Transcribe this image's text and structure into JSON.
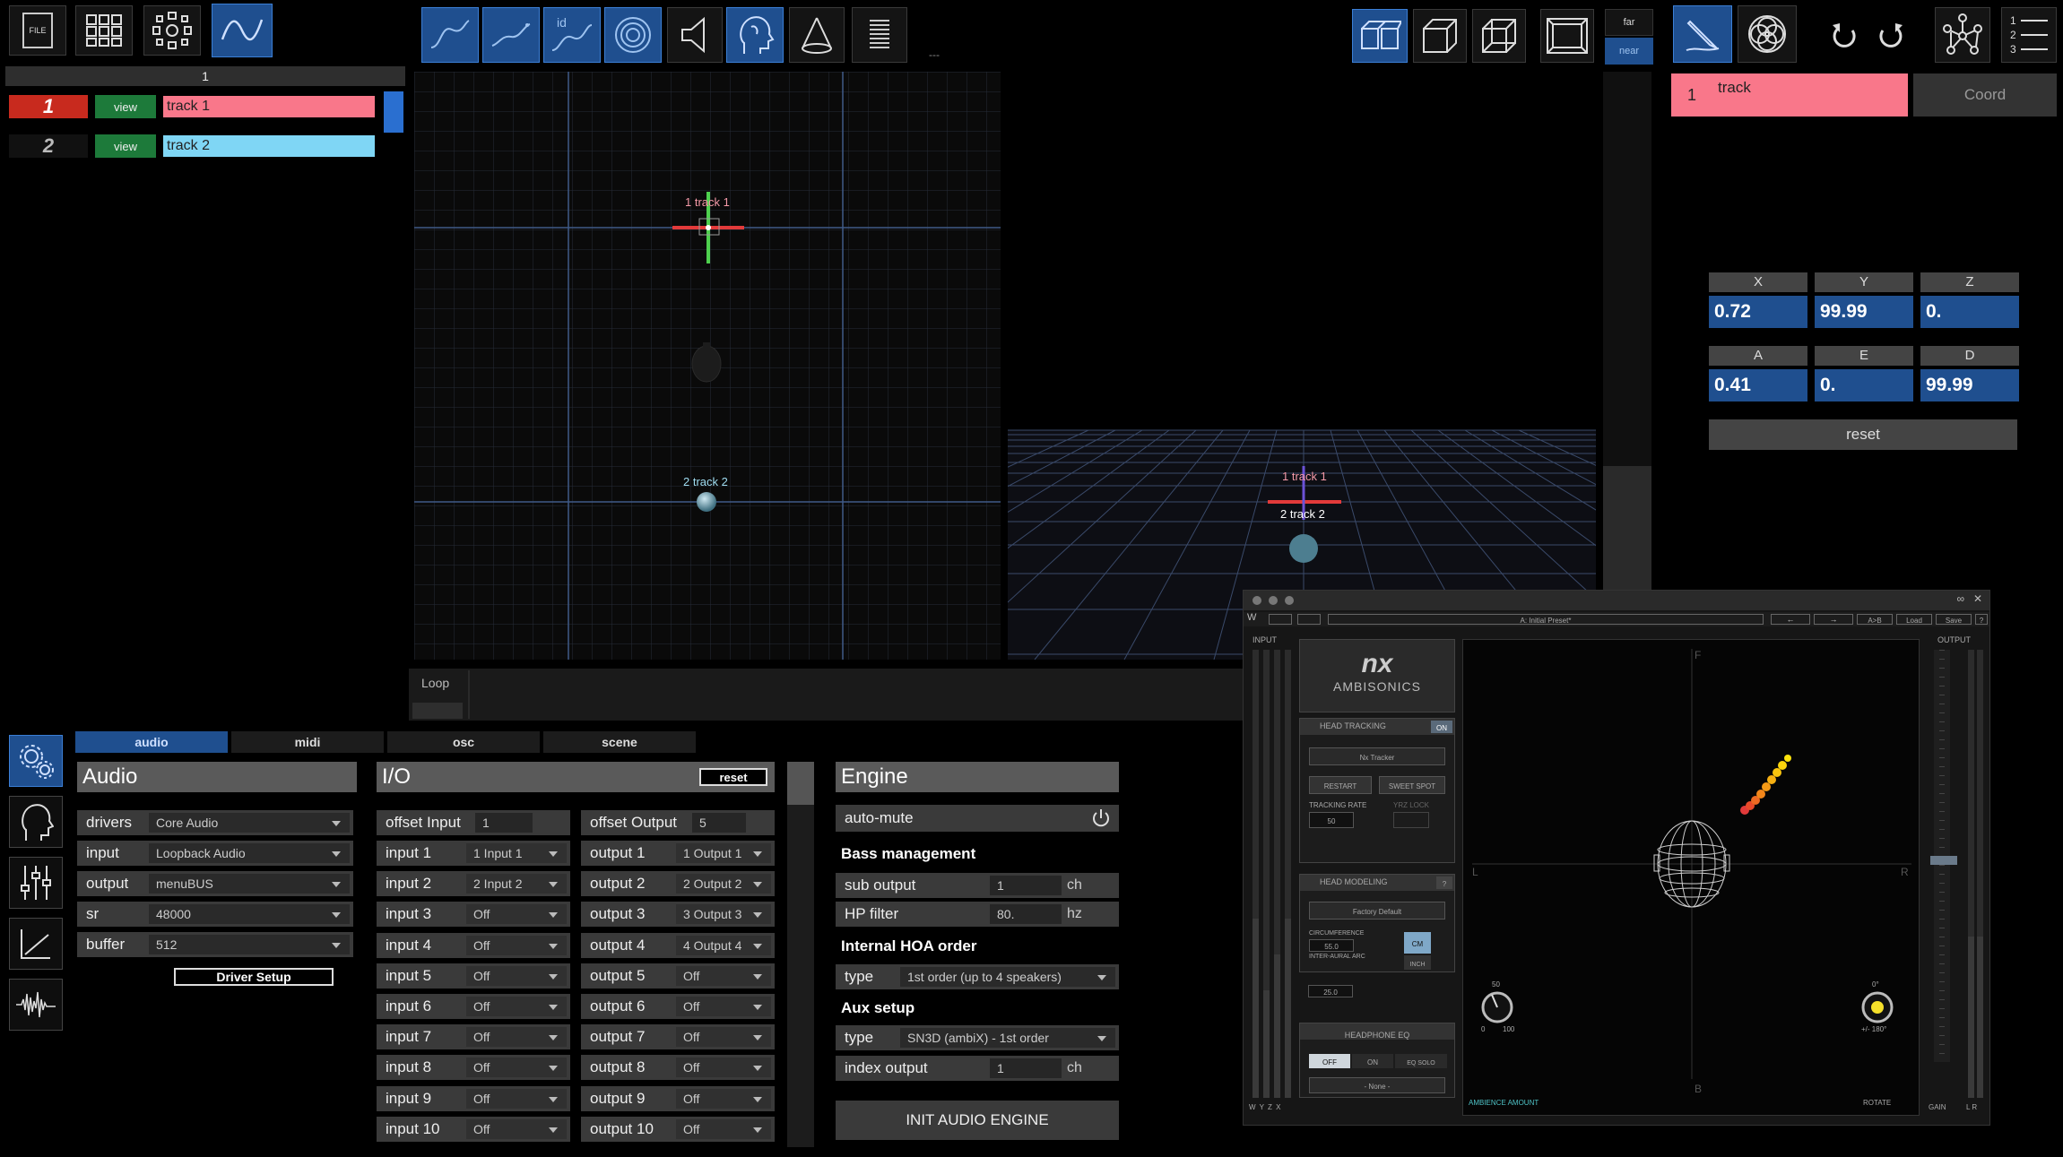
{
  "toolbar": {
    "file_label": "FILE",
    "dashes": "---"
  },
  "view_switch": {
    "far": "far",
    "near": "near"
  },
  "track_header": {
    "label": "1"
  },
  "tracks": [
    {
      "num": "1",
      "view": "view",
      "name": "track 1",
      "color": "#f9778a"
    },
    {
      "num": "2",
      "view": "view",
      "name": "track 2",
      "color": "#7fd6f5"
    }
  ],
  "viewport2d": {
    "track1_label": "1 track 1",
    "track2_label": "2 track 2"
  },
  "viewport3d": {
    "track1_label": "1 track 1",
    "track2_label": "2 track 2"
  },
  "loop": {
    "label": "Loop"
  },
  "right_panel": {
    "track_num": "1",
    "track_name": "track",
    "coord_tab": "Coord",
    "coords": [
      {
        "h": "X",
        "v": "0.72"
      },
      {
        "h": "Y",
        "v": "99.99"
      },
      {
        "h": "Z",
        "v": "0."
      },
      {
        "h": "A",
        "v": "0.41"
      },
      {
        "h": "E",
        "v": "0."
      },
      {
        "h": "D",
        "v": "99.99"
      }
    ],
    "reset": "reset"
  },
  "tabs": [
    {
      "label": "audio",
      "active": true
    },
    {
      "label": "midi",
      "active": false
    },
    {
      "label": "osc",
      "active": false
    },
    {
      "label": "scene",
      "active": false
    }
  ],
  "audio": {
    "title": "Audio",
    "rows": [
      {
        "label": "drivers",
        "value": "Core Audio"
      },
      {
        "label": "input",
        "value": "Loopback Audio"
      },
      {
        "label": "output",
        "value": "menuBUS"
      },
      {
        "label": "sr",
        "value": "48000"
      },
      {
        "label": "buffer",
        "value": "512"
      }
    ],
    "driver_setup": "Driver Setup"
  },
  "io": {
    "title": "I/O",
    "reset": "reset",
    "offset_input": {
      "label": "offset Input",
      "value": "1"
    },
    "offset_output": {
      "label": "offset Output",
      "value": "5"
    },
    "inputs": [
      {
        "label": "input 1",
        "value": "1 Input 1"
      },
      {
        "label": "input 2",
        "value": "2 Input 2"
      },
      {
        "label": "input 3",
        "value": "Off"
      },
      {
        "label": "input 4",
        "value": "Off"
      },
      {
        "label": "input 5",
        "value": "Off"
      },
      {
        "label": "input 6",
        "value": "Off"
      },
      {
        "label": "input 7",
        "value": "Off"
      },
      {
        "label": "input 8",
        "value": "Off"
      },
      {
        "label": "input 9",
        "value": "Off"
      },
      {
        "label": "input 10",
        "value": "Off"
      }
    ],
    "outputs": [
      {
        "label": "output 1",
        "value": "1 Output 1"
      },
      {
        "label": "output 2",
        "value": "2 Output 2"
      },
      {
        "label": "output 3",
        "value": "3 Output 3"
      },
      {
        "label": "output 4",
        "value": "4 Output 4"
      },
      {
        "label": "output 5",
        "value": "Off"
      },
      {
        "label": "output 6",
        "value": "Off"
      },
      {
        "label": "output 7",
        "value": "Off"
      },
      {
        "label": "output 8",
        "value": "Off"
      },
      {
        "label": "output 9",
        "value": "Off"
      },
      {
        "label": "output 10",
        "value": "Off"
      }
    ]
  },
  "engine": {
    "title": "Engine",
    "auto_mute": "auto-mute",
    "bass_title": "Bass management",
    "sub_output": {
      "label": "sub output",
      "value": "1",
      "unit": "ch"
    },
    "hp_filter": {
      "label": "HP filter",
      "value": "80.",
      "unit": "hz"
    },
    "hoa_title": "Internal HOA order",
    "hoa_type": {
      "label": "type",
      "value": "1st order (up to 4 speakers)"
    },
    "aux_title": "Aux setup",
    "aux_type": {
      "label": "type",
      "value": "SN3D (ambiX) - 1st order"
    },
    "index_output": {
      "label": "index output",
      "value": "1",
      "unit": "ch"
    },
    "init": "INIT AUDIO ENGINE"
  },
  "nx": {
    "preset": "A: Initial Preset*",
    "ab": "A>B",
    "load": "Load",
    "save": "Save",
    "help": "?",
    "input_label": "INPUT",
    "output_label": "OUTPUT",
    "logo": "nx",
    "logo_sub": "AMBISONICS",
    "head_tracking": "HEAD TRACKING",
    "ht_on": "ON",
    "tracker": "Nx Tracker",
    "restart": "RESTART",
    "sweet_spot": "SWEET SPOT",
    "tracking_rate": "TRACKING RATE",
    "tracking_rate_val": "50",
    "yrz_lock": "YRZ LOCK",
    "head_modeling": "HEAD MODELING",
    "hm_help": "?",
    "factory_default": "Factory Default",
    "circumference": "CIRCUMFERENCE",
    "circ_val": "55.0",
    "inter_aural": "INTER-AURAL ARC",
    "arc_val": "25.0",
    "cm": "CM",
    "inch": "INCH",
    "headphone_eq": "HEADPHONE EQ",
    "eq_off": "OFF",
    "eq_on": "ON",
    "eq_solo": "EQ SOLO",
    "eq_none": "- None -",
    "f": "F",
    "b": "B",
    "l": "L",
    "r": "R",
    "amb_top": "50",
    "amb_min": "0",
    "amb_max": "100",
    "ambience": "AMBIENCE AMOUNT",
    "rot_top": "0°",
    "rot_range": "+/- 180°",
    "rotate": "ROTATE",
    "gain": "GAIN",
    "gain_lr": "L R",
    "wyzx": "W Y Z X"
  }
}
